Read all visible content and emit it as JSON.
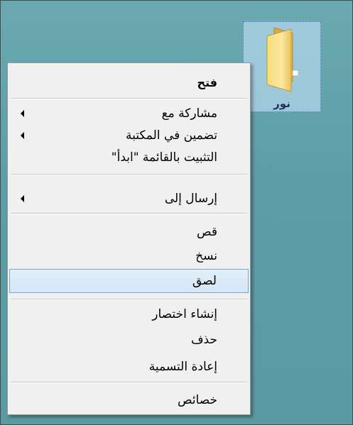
{
  "desktop": {
    "icon": {
      "label": "نور",
      "icon_name": "folder-icon"
    }
  },
  "context_menu": {
    "items": [
      {
        "label": "فتح",
        "bold": true,
        "submenu": false
      },
      {
        "label": "مشاركة مع",
        "submenu": true
      },
      {
        "label": "تضمين في المكتبة",
        "submenu": true
      },
      {
        "label": "التثبيت بالقائمة \"ابدأ\"",
        "submenu": false
      },
      {
        "label": "إرسال إلى",
        "submenu": true
      },
      {
        "label": "قص",
        "submenu": false
      },
      {
        "label": "نسخ",
        "submenu": false
      },
      {
        "label": "لصق",
        "submenu": false,
        "highlighted": true
      },
      {
        "label": "إنشاء اختصار",
        "submenu": false
      },
      {
        "label": "حذف",
        "submenu": false
      },
      {
        "label": "إعادة التسمية",
        "submenu": false
      },
      {
        "label": "خصائص",
        "submenu": false
      }
    ],
    "highlight_color": "#d4e6f7"
  }
}
